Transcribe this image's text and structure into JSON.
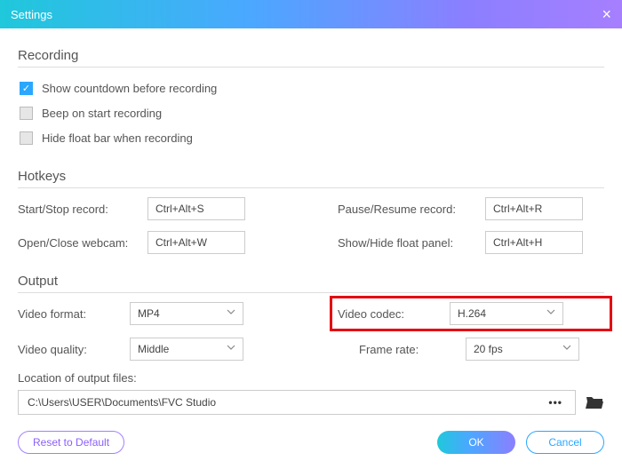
{
  "window": {
    "title": "Settings"
  },
  "recording": {
    "heading": "Recording",
    "opt_countdown": "Show countdown before recording",
    "opt_beep": "Beep on start recording",
    "opt_hidefloat": "Hide float bar when recording"
  },
  "hotkeys": {
    "heading": "Hotkeys",
    "startstop_label": "Start/Stop record:",
    "startstop_value": "Ctrl+Alt+S",
    "pauseresume_label": "Pause/Resume record:",
    "pauseresume_value": "Ctrl+Alt+R",
    "webcam_label": "Open/Close webcam:",
    "webcam_value": "Ctrl+Alt+W",
    "floatpanel_label": "Show/Hide float panel:",
    "floatpanel_value": "Ctrl+Alt+H"
  },
  "output": {
    "heading": "Output",
    "format_label": "Video format:",
    "format_value": "MP4",
    "codec_label": "Video codec:",
    "codec_value": "H.264",
    "quality_label": "Video quality:",
    "quality_value": "Middle",
    "fps_label": "Frame rate:",
    "fps_value": "20 fps",
    "location_label": "Location of output files:",
    "location_value": "C:\\Users\\USER\\Documents\\FVC Studio"
  },
  "footer": {
    "reset": "Reset to Default",
    "ok": "OK",
    "cancel": "Cancel"
  }
}
